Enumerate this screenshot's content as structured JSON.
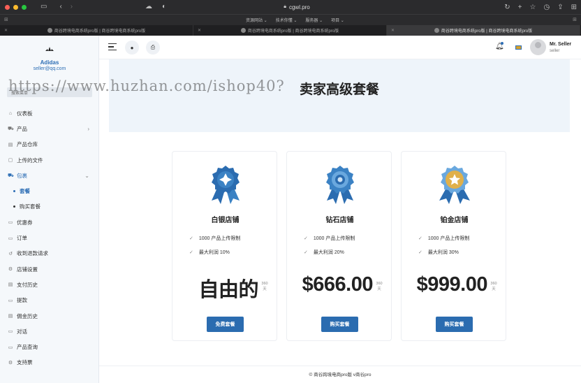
{
  "browser": {
    "url": "cgwl.pro",
    "bookmarks": [
      "资源网站 ⌄",
      "技术你懂 ⌄",
      "服务器 ⌄",
      "项目 ⌄"
    ],
    "tabs": [
      {
        "title": "商谷跨境电商系统pro版 | 商谷跨境电商系统pro版",
        "active": false
      },
      {
        "title": "商谷跨境电商系统pro版 | 商谷跨境电商系统pro版",
        "active": false
      },
      {
        "title": "商谷跨境电商系统pro版 | 商谷跨境电商系统pro版",
        "active": true
      }
    ]
  },
  "sidebar": {
    "logo_icon": "adidas-logo-icon",
    "shop_name": "Adidas",
    "email": "seller@qq.com",
    "search_placeholder": "搜索菜单",
    "items": [
      {
        "label": "仪表板",
        "icon": "dashboard-icon"
      },
      {
        "label": "产品",
        "icon": "cart-icon",
        "chevron": "›"
      },
      {
        "label": "产品仓库",
        "icon": "warehouse-icon"
      },
      {
        "label": "上传的文件",
        "icon": "folder-icon"
      },
      {
        "label": "包裹",
        "icon": "package-icon",
        "chevron": "⌄",
        "active": true
      },
      {
        "label": "套餐",
        "sub": true,
        "current": true
      },
      {
        "label": "购买套餐",
        "sub": true
      },
      {
        "label": "优惠券",
        "icon": "coupon-icon"
      },
      {
        "label": "订单",
        "icon": "order-icon"
      },
      {
        "label": "收到退款请求",
        "icon": "refund-icon"
      },
      {
        "label": "店铺设置",
        "icon": "settings-icon"
      },
      {
        "label": "支付历史",
        "icon": "history-icon"
      },
      {
        "label": "提款",
        "icon": "withdraw-icon"
      },
      {
        "label": "佣金历史",
        "icon": "commission-icon"
      },
      {
        "label": "对话",
        "icon": "chat-icon"
      },
      {
        "label": "产品查询",
        "icon": "query-icon"
      },
      {
        "label": "支持票",
        "icon": "support-icon"
      }
    ]
  },
  "header": {
    "user_name": "Mr. Seller",
    "user_role": "seller"
  },
  "main": {
    "page_title": "卖家高级套餐",
    "watermark": "https://www.huzhan.com/ishop40?",
    "packages": [
      {
        "name": "白银店铺",
        "features": [
          "1000 产品上传限制",
          "最大利润 10%"
        ],
        "price": "自由的",
        "duration": "360 天",
        "button": "免费套餐",
        "badge": "silver-badge-icon"
      },
      {
        "name": "钻石店铺",
        "features": [
          "1000 产品上传限制",
          "最大利润 20%"
        ],
        "price": "$666.00",
        "duration": "360 天",
        "button": "购买套餐",
        "badge": "diamond-badge-icon"
      },
      {
        "name": "铂金店铺",
        "features": [
          "1000 产品上传限制",
          "最大利润 30%"
        ],
        "price": "$999.00",
        "duration": "360 天",
        "button": "购买套餐",
        "badge": "platinum-badge-icon"
      }
    ],
    "footer": "© 商谷跨境电商pro版 v商谷pro"
  },
  "colors": {
    "accent": "#2b6cb0",
    "sidebar_bg": "#f5f8fb",
    "banner_bg": "#eef4fa",
    "gold": "#e0b04a"
  }
}
